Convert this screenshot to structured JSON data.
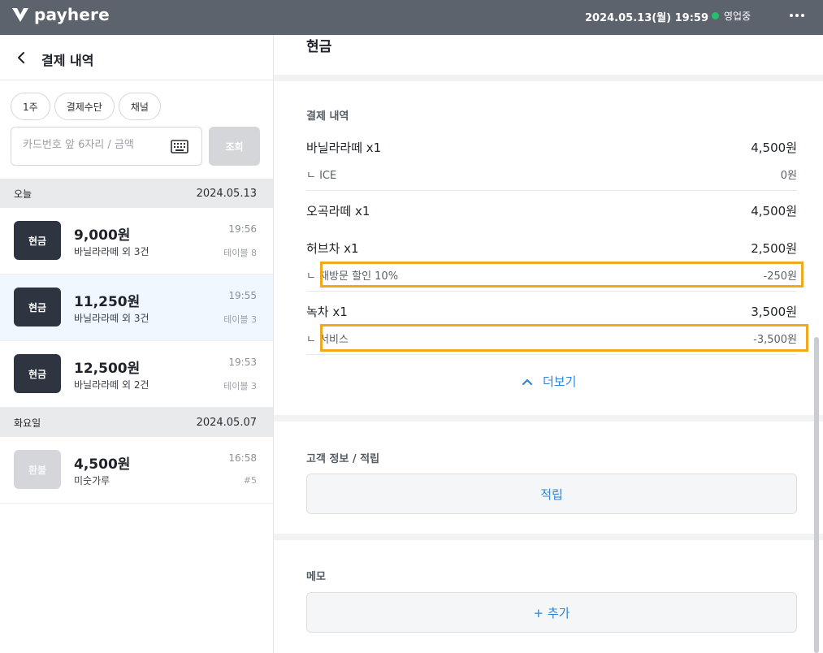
{
  "topbar": {
    "logo_text": "payhere",
    "datetime": "2024.05.13(월) 19:59",
    "status_label": "영업중",
    "status_color": "#23c16b",
    "more_icon": "more-horizontal-icon"
  },
  "left": {
    "title": "결제 내역",
    "back_icon": "chevron-left-icon",
    "filters": [
      "1주",
      "결제수단",
      "채널"
    ],
    "search": {
      "placeholder": "카드번호 앞 6자리 / 금액",
      "value": "",
      "keyboard_icon": "keyboard-icon"
    },
    "search_button": "조회",
    "groups": [
      {
        "day": "오늘",
        "date": "2024.05.13",
        "items": [
          {
            "method": "현금",
            "amount": "9,000원",
            "desc": "바닐라라떼 외 3건",
            "time": "19:56",
            "table": "테이블 8"
          },
          {
            "method": "현금",
            "amount": "11,250원",
            "desc": "바닐라라떼 외 3건",
            "time": "19:55",
            "table": "테이블 3"
          },
          {
            "method": "현금",
            "amount": "12,500원",
            "desc": "바닐라라떼 외 2건",
            "time": "19:53",
            "table": "테이블 3"
          }
        ]
      },
      {
        "day": "화요일",
        "date": "2024.05.07",
        "items": [
          {
            "method": "환불",
            "amount": "4,500원",
            "desc": "미숫가루",
            "time": "16:58",
            "table": "#5"
          }
        ]
      }
    ]
  },
  "right": {
    "title": "현금",
    "payment_section_label": "결제 내역",
    "lines": [
      {
        "name": "바닐라라떼  x1",
        "price": "4,500원",
        "sub": {
          "name": "ㄴ  ICE",
          "price": "0원"
        }
      },
      {
        "name": "오곡라떼  x1",
        "price": "4,500원"
      },
      {
        "name": "허브차  x1",
        "price": "2,500원",
        "sub": {
          "name": "ㄴ  재방문 할인 10%",
          "price": "-250원"
        }
      },
      {
        "name": "녹차  x1",
        "price": "3,500원",
        "sub": {
          "name": "ㄴ  서비스",
          "price": "-3,500원"
        }
      }
    ],
    "more_label": "더보기",
    "customer_section_label": "고객 정보 / 적립",
    "earn_button": "적립",
    "memo_section_label": "메모",
    "add_button": "+ 추가",
    "highlight_color": "#f0a81c",
    "link_color": "#2f85d4"
  }
}
